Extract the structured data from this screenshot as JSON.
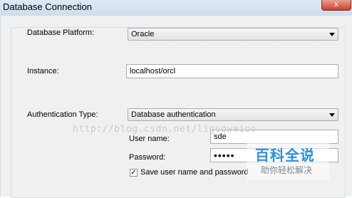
{
  "window": {
    "title": "Database Connection",
    "close_label": "x"
  },
  "platform": {
    "label": "Database Platform:",
    "value": "Oracle"
  },
  "instance": {
    "label": "Instance:",
    "value": "localhost/orcl"
  },
  "auth": {
    "label": "Authentication Type:",
    "value": "Database authentication",
    "username_label": "User name:",
    "username_value": "sde",
    "password_label": "Password:",
    "password_value": "•••••",
    "save_label": "Save user name and password",
    "save_checked": true,
    "check_glyph": "✓"
  },
  "watermark": {
    "text": "http://blog.csdn.net/liguoweioo"
  },
  "badge": {
    "main": "百科全说",
    "sub": "助你轻松解决"
  },
  "colors": {
    "dialog_bg": "#f0f0f0",
    "titlebar": "#cfdcec",
    "badge_blue": "#2d8ee0"
  }
}
